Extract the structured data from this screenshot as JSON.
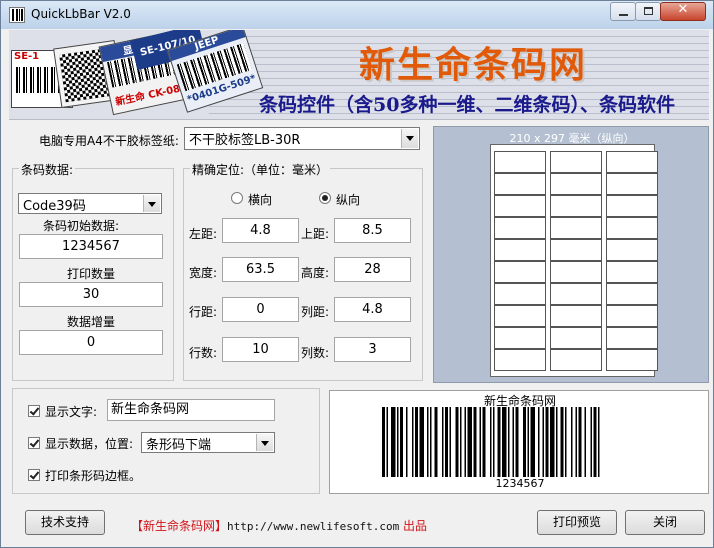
{
  "window": {
    "title": "QuickLbBar V2.0"
  },
  "banner": {
    "title": "新生命条码网",
    "subtitle": "条码控件（含50多种一维、二维条码）、条码软件",
    "tags": [
      "显示器",
      "SE-107/10",
      "新生命  CK-08",
      "JEEP",
      "*0401G-509*",
      "SE-1"
    ]
  },
  "paper": {
    "label": "电脑专用A4不干胶标签纸:",
    "selected": "不干胶标签LB-30R"
  },
  "barcode_data": {
    "group_title": "条码数据:",
    "type_selected": "Code39码",
    "initial_label": "条码初始数据:",
    "initial_value": "1234567",
    "print_count_label": "打印数量",
    "print_count_value": "30",
    "increment_label": "数据增量",
    "increment_value": "0"
  },
  "positioning": {
    "group_title": "精确定位:（单位：毫米）",
    "orient_h": "横向",
    "orient_v": "纵向",
    "orient_selected": "纵向",
    "fields": {
      "left": {
        "label": "左距:",
        "value": "4.8"
      },
      "top": {
        "label": "上距:",
        "value": "8.5"
      },
      "width": {
        "label": "宽度:",
        "value": "63.5"
      },
      "height": {
        "label": "高度:",
        "value": "28"
      },
      "rowgap": {
        "label": "行距:",
        "value": "0"
      },
      "colgap": {
        "label": "列距:",
        "value": "4.8"
      },
      "rows": {
        "label": "行数:",
        "value": "10"
      },
      "cols": {
        "label": "列数:",
        "value": "3"
      }
    }
  },
  "preview": {
    "caption": "210 x 297 毫米（纵向）",
    "rows": 10,
    "cols": 3
  },
  "options": {
    "show_text_label": "显示文字:",
    "show_text_value": "新生命条码网",
    "show_text_checked": true,
    "show_data_label": "显示数据，位置:",
    "show_data_position": "条形码下端",
    "show_data_checked": true,
    "print_border_label": "打印条形码边框。",
    "print_border_checked": true
  },
  "barcode_preview": {
    "top_text": "新生命条码网",
    "bottom_text": "1234567"
  },
  "footer": {
    "support_button": "技术支持",
    "credit_name": "【新生命条码网】",
    "credit_url": "http://www.newlifesoft.com",
    "credit_suffix": "出品",
    "print_preview_button": "打印预览",
    "close_button": "关闭"
  },
  "colors": {
    "banner_title": "#e05a0a",
    "banner_sub": "#1a1a8c",
    "credit": "#d0151a",
    "preview_bg": "#b4c0d2"
  }
}
